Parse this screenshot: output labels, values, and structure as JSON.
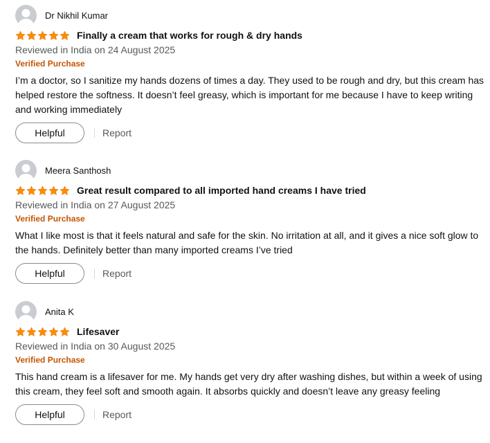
{
  "icons": {
    "avatar": "default-user-avatar-icon",
    "star": "star-filled-icon"
  },
  "colors": {
    "star": "#ff8c00",
    "verified": "#c45500",
    "meta": "#565959",
    "avatar_bg": "#c9ccd0"
  },
  "reviews": [
    {
      "reviewer": "Dr Nikhil Kumar",
      "rating": 5,
      "title": "Finally a cream that works for rough & dry hands",
      "date": "Reviewed in India on 24 August 2025",
      "verified": "Verified Purchase",
      "body": "I’m a doctor, so I sanitize my hands dozens of times a day. They used to be rough and dry, but this cream has helped restore the softness. It doesn’t feel greasy, which is important for me because I have to keep writing and working immediately",
      "helpful_label": "Helpful",
      "report_label": "Report"
    },
    {
      "reviewer": "Meera Santhosh",
      "rating": 5,
      "title": "Great result compared to all imported hand creams I have tried",
      "date": "Reviewed in India on 27 August 2025",
      "verified": "Verified Purchase",
      "body": "What I like most is that it feels natural and safe for the skin. No irritation at all, and it gives a nice soft glow to the hands. Definitely better than many imported creams I’ve tried",
      "helpful_label": "Helpful",
      "report_label": "Report"
    },
    {
      "reviewer": "Anita K",
      "rating": 5,
      "title": "Lifesaver",
      "date": "Reviewed in India on 30 August 2025",
      "verified": "Verified Purchase",
      "body": "This hand cream is a lifesaver for me. My hands get very dry after washing dishes, but within a week of using this cream, they feel soft and smooth again. It absorbs quickly and doesn’t leave any greasy feeling",
      "helpful_label": "Helpful",
      "report_label": "Report"
    }
  ]
}
